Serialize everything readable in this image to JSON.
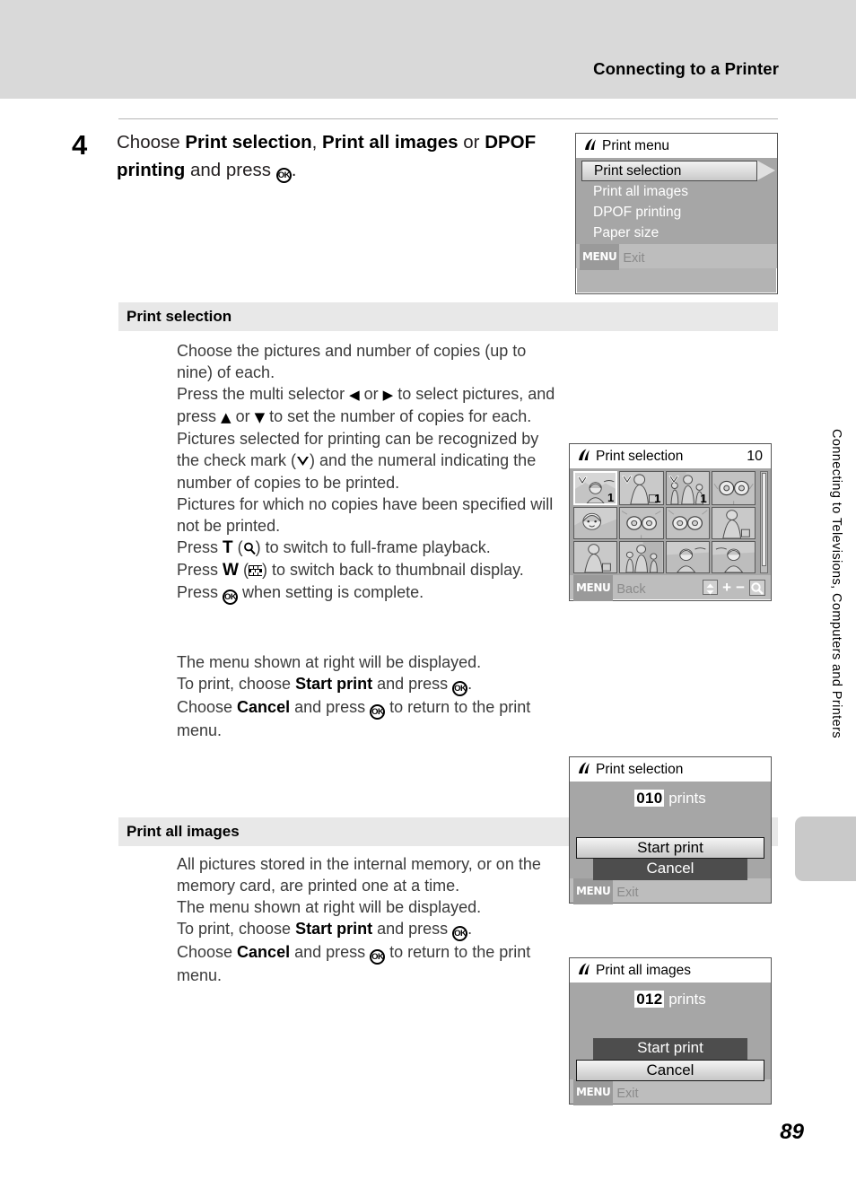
{
  "header": {
    "title": "Connecting to a Printer"
  },
  "step": {
    "number": "4",
    "text_parts": [
      {
        "t": "Choose ",
        "b": false
      },
      {
        "t": "Print selection",
        "b": true
      },
      {
        "t": ", ",
        "b": false
      },
      {
        "t": "Print all images",
        "b": true
      },
      {
        "t": " or ",
        "b": false
      },
      {
        "t": "DPOF printing",
        "b": true
      },
      {
        "t": " and press ",
        "b": false
      },
      {
        "t": "OK-button",
        "b": false,
        "icon": "ok"
      },
      {
        "t": ".",
        "b": false
      }
    ]
  },
  "sections": [
    {
      "id": "print-selection",
      "heading": "Print selection"
    },
    {
      "id": "print-all-images",
      "heading": "Print all images"
    }
  ],
  "paragraphs": {
    "print_selection_1": "Choose the pictures and number of copies (up to nine) of each.\nPress the multi selector ◀ or ▶ to select pictures, and press ▲ or ▼ to set the number of copies for each.\nPictures selected for printing can be recognized by the check mark (✔) and the numeral indicating the number of copies to be printed.\nPictures for which no copies have been specified will not be printed.\nPress T (🔍) to switch to full-frame playback.\nPress W (▦) to switch back to thumbnail display.\nPress OK when setting is complete.",
    "print_selection_2": "The menu shown at right will be displayed.\nTo print, choose Start print and press OK.\nChoose Cancel and press OK to return to the print menu.",
    "print_all_1": "All pictures stored in the internal memory, or on the memory card, are printed one at a time.\nThe menu shown at right will be displayed.\nTo print, choose Start print and press OK.\nChoose Cancel and press OK to return to the print menu."
  },
  "screens": {
    "print_menu": {
      "title": "Print menu",
      "items": [
        {
          "label": "Print selection",
          "selected": true
        },
        {
          "label": "Print all images",
          "selected": false
        },
        {
          "label": "DPOF printing",
          "selected": false
        },
        {
          "label": "Paper size",
          "selected": false
        }
      ],
      "footer_key": "MENU",
      "footer_label": "Exit"
    },
    "print_selection": {
      "title": "Print selection",
      "count": "10",
      "footer_key": "MENU",
      "footer_label": "Back",
      "plus_label": "+",
      "minus_label": "−",
      "thumbnails": [
        {
          "checked": true,
          "copies": "1",
          "active": true
        },
        {
          "checked": true,
          "copies": "1",
          "active": false
        },
        {
          "checked": true,
          "copies": "1",
          "active": false
        },
        {
          "checked": false,
          "copies": "",
          "active": false
        },
        {
          "checked": false,
          "copies": "",
          "active": false
        },
        {
          "checked": false,
          "copies": "",
          "active": false
        },
        {
          "checked": false,
          "copies": "",
          "active": false
        },
        {
          "checked": false,
          "copies": "",
          "active": false
        },
        {
          "checked": false,
          "copies": "",
          "active": false
        },
        {
          "checked": false,
          "copies": "",
          "active": false
        },
        {
          "checked": false,
          "copies": "",
          "active": false
        },
        {
          "checked": false,
          "copies": "",
          "active": false
        }
      ]
    },
    "confirm_selection": {
      "title": "Print selection",
      "count": "010",
      "count_unit": "prints",
      "start_label": "Start print",
      "cancel_label": "Cancel",
      "highlighted": "start",
      "footer_key": "MENU",
      "footer_label": "Exit"
    },
    "confirm_all": {
      "title": "Print all images",
      "count": "012",
      "count_unit": "prints",
      "start_label": "Start print",
      "cancel_label": "Cancel",
      "highlighted": "cancel",
      "footer_key": "MENU",
      "footer_label": "Exit"
    }
  },
  "side_tab": {
    "text": "Connecting to Televisions, Computers and Printers"
  },
  "page_number": "89",
  "colors": {
    "header_band": "#d9d9d9",
    "section_bar": "#e8e8e8",
    "lcd_body": "#a6a6a6",
    "lcd_footer": "#bdbdbd",
    "side_tab": "#c9c9c9"
  }
}
